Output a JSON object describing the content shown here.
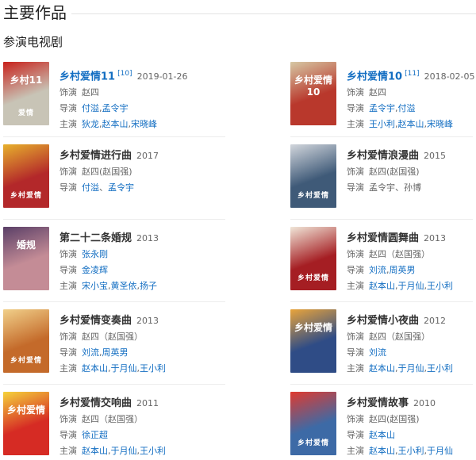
{
  "header": {
    "title": "主要作品",
    "subtitle": "参演电视剧"
  },
  "works": [
    {
      "title": "乡村爱情11",
      "cite": "[10]",
      "year": "2019-01-26",
      "title_link": true,
      "poster": {
        "bg": "#c8c4b6",
        "accent": "#c8221c",
        "top": "乡村11",
        "bottom": "爱情"
      },
      "role_label": "饰演",
      "role": [
        {
          "t": "赵四",
          "link": false
        }
      ],
      "director_label": "导演",
      "directors": [
        {
          "t": "付溢",
          "link": true
        },
        {
          "t": ",",
          "link": false
        },
        {
          "t": "孟令宇",
          "link": true
        }
      ],
      "cast_label": "主演",
      "cast": [
        {
          "t": "狄龙",
          "link": true
        },
        {
          "t": ",",
          "link": false
        },
        {
          "t": "赵本山",
          "link": true
        },
        {
          "t": ",",
          "link": false
        },
        {
          "t": "宋晓峰",
          "link": true
        }
      ]
    },
    {
      "title": "乡村爱情10",
      "cite": "[11]",
      "year": "2018-02-05",
      "title_link": true,
      "poster": {
        "bg": "#b9382c",
        "accent": "#d6c8a4",
        "top": "乡村爱情10",
        "bottom": ""
      },
      "role_label": "饰演",
      "role": [
        {
          "t": "赵四",
          "link": false
        }
      ],
      "director_label": "导演",
      "directors": [
        {
          "t": "孟令宇",
          "link": true
        },
        {
          "t": ",",
          "link": false
        },
        {
          "t": "付溢",
          "link": true
        }
      ],
      "cast_label": "主演",
      "cast": [
        {
          "t": "王小利",
          "link": true
        },
        {
          "t": ",",
          "link": false
        },
        {
          "t": "赵本山",
          "link": true
        },
        {
          "t": ",",
          "link": false
        },
        {
          "t": "宋晓峰",
          "link": true
        }
      ]
    },
    {
      "title": "乡村爱情进行曲",
      "cite": "",
      "year": "2017",
      "title_link": false,
      "poster": {
        "bg": "#b3282a",
        "accent": "#e7b12d",
        "top": "",
        "bottom": "乡村爱情"
      },
      "role_label": "饰演",
      "role": [
        {
          "t": "赵四(赵国强)",
          "link": false
        }
      ],
      "director_label": "导演",
      "directors": [
        {
          "t": "付溢",
          "link": true
        },
        {
          "t": "、",
          "link": false
        },
        {
          "t": "孟令宇",
          "link": true
        }
      ],
      "cast_label": "",
      "cast": []
    },
    {
      "title": "乡村爱情浪漫曲",
      "cite": "",
      "year": "2015",
      "title_link": false,
      "poster": {
        "bg": "#3f5a78",
        "accent": "#d2d6dc",
        "top": "",
        "bottom": "乡村爱情"
      },
      "role_label": "饰演",
      "role": [
        {
          "t": "赵四(赵国强)",
          "link": false
        }
      ],
      "director_label": "导演",
      "directors": [
        {
          "t": "孟令宇、孙博",
          "link": false
        }
      ],
      "cast_label": "",
      "cast": []
    },
    {
      "title": "第二十二条婚规",
      "cite": "",
      "year": "2013",
      "title_link": false,
      "poster": {
        "bg": "#c48c96",
        "accent": "#5a3f67",
        "top": "婚规",
        "bottom": ""
      },
      "role_label": "饰演",
      "role": [
        {
          "t": "张永刚",
          "link": true
        }
      ],
      "director_label": "导演",
      "directors": [
        {
          "t": "金凌辉",
          "link": true
        }
      ],
      "cast_label": "主演",
      "cast": [
        {
          "t": "宋小宝",
          "link": true
        },
        {
          "t": ",",
          "link": false
        },
        {
          "t": "黄圣依",
          "link": true
        },
        {
          "t": ",",
          "link": false
        },
        {
          "t": "扬子",
          "link": true
        }
      ]
    },
    {
      "title": "乡村爱情圆舞曲",
      "cite": "",
      "year": "2013",
      "title_link": false,
      "poster": {
        "bg": "#a51e23",
        "accent": "#f0e6d8",
        "top": "",
        "bottom": "乡村爱情"
      },
      "role_label": "饰演",
      "role": [
        {
          "t": "赵四（赵国强）",
          "link": false
        }
      ],
      "director_label": "导演",
      "directors": [
        {
          "t": "刘流",
          "link": true
        },
        {
          "t": ",",
          "link": false
        },
        {
          "t": "周英男",
          "link": true
        }
      ],
      "cast_label": "主演",
      "cast": [
        {
          "t": "赵本山",
          "link": true
        },
        {
          "t": ",",
          "link": false
        },
        {
          "t": "于月仙",
          "link": true
        },
        {
          "t": ",",
          "link": false
        },
        {
          "t": "王小利",
          "link": true
        }
      ]
    },
    {
      "title": "乡村爱情变奏曲",
      "cite": "",
      "year": "2013",
      "title_link": false,
      "poster": {
        "bg": "#c46a2a",
        "accent": "#f1d08a",
        "top": "",
        "bottom": "乡村爱情"
      },
      "role_label": "饰演",
      "role": [
        {
          "t": "赵四（赵国强）",
          "link": false
        }
      ],
      "director_label": "导演",
      "directors": [
        {
          "t": "刘流",
          "link": true
        },
        {
          "t": ",",
          "link": false
        },
        {
          "t": "周英男",
          "link": true
        }
      ],
      "cast_label": "主演",
      "cast": [
        {
          "t": "赵本山",
          "link": true
        },
        {
          "t": ",",
          "link": false
        },
        {
          "t": "于月仙",
          "link": true
        },
        {
          "t": ",",
          "link": false
        },
        {
          "t": "王小利",
          "link": true
        }
      ]
    },
    {
      "title": "乡村爱情小夜曲",
      "cite": "",
      "year": "2012",
      "title_link": false,
      "poster": {
        "bg": "#2f4c86",
        "accent": "#e9a43b",
        "top": "乡村爱情",
        "bottom": ""
      },
      "role_label": "饰演",
      "role": [
        {
          "t": "赵四（赵国强）",
          "link": false
        }
      ],
      "director_label": "导演",
      "directors": [
        {
          "t": "刘流",
          "link": true
        }
      ],
      "cast_label": "主演",
      "cast": [
        {
          "t": "赵本山",
          "link": true
        },
        {
          "t": ",",
          "link": false
        },
        {
          "t": "于月仙",
          "link": true
        },
        {
          "t": ",",
          "link": false
        },
        {
          "t": "王小利",
          "link": true
        }
      ]
    },
    {
      "title": "乡村爱情交响曲",
      "cite": "",
      "year": "2011",
      "title_link": false,
      "poster": {
        "bg": "#d62b24",
        "accent": "#f5d33b",
        "top": "乡村爱情",
        "bottom": ""
      },
      "role_label": "饰演",
      "role": [
        {
          "t": "赵四（赵国强）",
          "link": false
        }
      ],
      "director_label": "导演",
      "directors": [
        {
          "t": "徐正超",
          "link": true
        }
      ],
      "cast_label": "主演",
      "cast": [
        {
          "t": "赵本山",
          "link": true
        },
        {
          "t": ",",
          "link": false
        },
        {
          "t": "于月仙",
          "link": true
        },
        {
          "t": ",",
          "link": false
        },
        {
          "t": "王小利",
          "link": true
        }
      ]
    },
    {
      "title": "乡村爱情故事",
      "cite": "",
      "year": "2010",
      "title_link": false,
      "poster": {
        "bg": "#3d6aa6",
        "accent": "#e03a2f",
        "top": "",
        "bottom": "乡村爱情"
      },
      "role_label": "饰演",
      "role": [
        {
          "t": "赵四(赵国强)",
          "link": false
        }
      ],
      "director_label": "导演",
      "directors": [
        {
          "t": "赵本山",
          "link": true
        }
      ],
      "cast_label": "主演",
      "cast": [
        {
          "t": "赵本山",
          "link": true
        },
        {
          "t": ",",
          "link": false
        },
        {
          "t": "王小利",
          "link": true
        },
        {
          "t": ",",
          "link": false
        },
        {
          "t": "于月仙",
          "link": true
        }
      ]
    }
  ]
}
